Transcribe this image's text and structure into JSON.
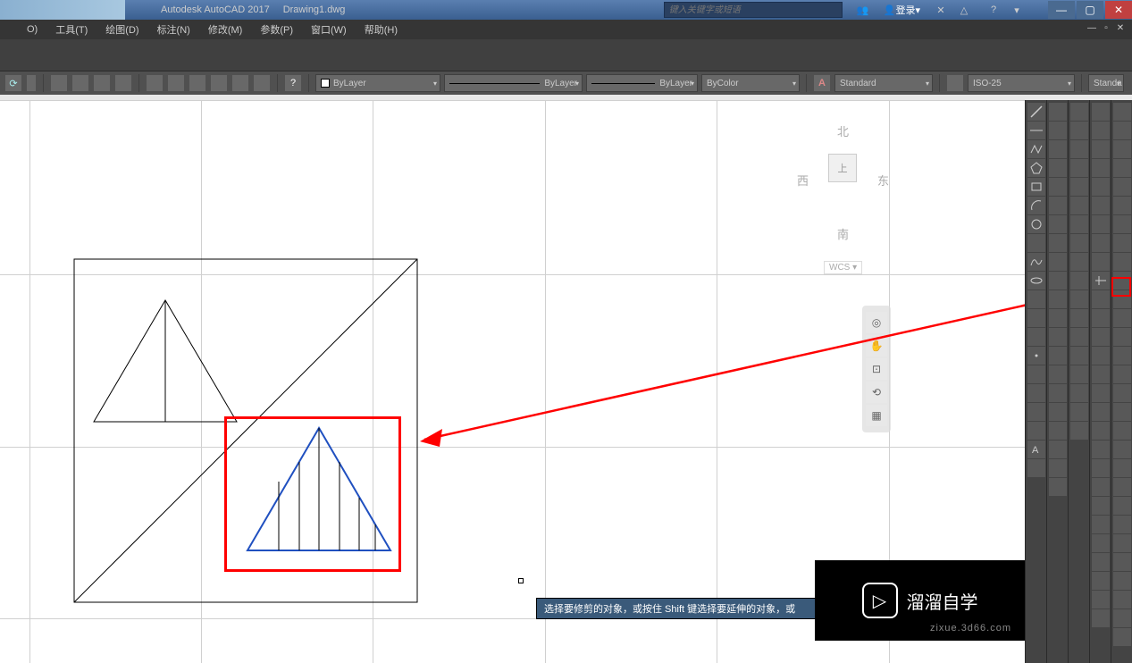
{
  "title": {
    "app": "Autodesk AutoCAD 2017",
    "file": "Drawing1.dwg"
  },
  "search": {
    "placeholder": "键入关键字或短语"
  },
  "login": {
    "label": "登录"
  },
  "menu": {
    "items": [
      "O)",
      "工具(T)",
      "绘图(D)",
      "标注(N)",
      "修改(M)",
      "参数(P)",
      "窗口(W)",
      "帮助(H)"
    ]
  },
  "properties": {
    "layer": "ByLayer",
    "linetype": "ByLayer",
    "lineweight": "ByLayer",
    "color": "ByColor",
    "textstyle": "Standard",
    "dimstyle": "ISO-25",
    "tablestyle": "Standa"
  },
  "viewcube": {
    "north": "北",
    "south": "南",
    "east": "东",
    "west": "西",
    "top": "上",
    "wcs": "WCS"
  },
  "tooltip": "选择要修剪的对象，或按住 Shift 键选择要延伸的对象，或",
  "watermark": {
    "text": "溜溜自学",
    "url": "zixue.3d66.com"
  },
  "colors": {
    "red": "#ff0000",
    "blue": "#2050c0"
  }
}
